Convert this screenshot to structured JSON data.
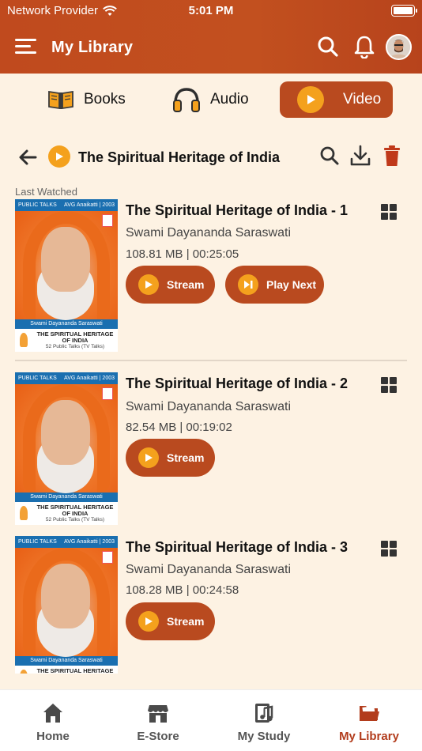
{
  "status_bar": {
    "carrier": "Network Provider",
    "time": "5:01 PM"
  },
  "header": {
    "title": "My Library"
  },
  "tabs": [
    {
      "label": "Books",
      "icon": "book-icon",
      "active": false
    },
    {
      "label": "Audio",
      "icon": "headphones-icon",
      "active": false
    },
    {
      "label": "Video",
      "icon": "play-icon",
      "active": true
    }
  ],
  "subheader": {
    "title": "The Spiritual Heritage of India"
  },
  "last_watched_label": "Last Watched",
  "thumbnail": {
    "series_label": "PUBLIC TALKS",
    "venue": "AVG Anaikatti | 2003",
    "speaker": "Swami Dayananda Saraswati",
    "book_title": "THE SPIRITUAL HERITAGE OF INDIA",
    "talks": "52 Public Talks (TV Talks)"
  },
  "items": [
    {
      "title": "The Spiritual Heritage of India - 1",
      "author": "Swami Dayananda Saraswati",
      "meta": "108.81 MB | 00:25:05",
      "stream_label": "Stream",
      "play_next_label": "Play Next"
    },
    {
      "title": "The Spiritual Heritage of India - 2",
      "author": "Swami Dayananda Saraswati",
      "meta": "82.54 MB | 00:19:02",
      "stream_label": "Stream"
    },
    {
      "title": "The Spiritual Heritage of India - 3",
      "author": "Swami Dayananda Saraswati",
      "meta": "108.28 MB | 00:24:58",
      "stream_label": "Stream"
    }
  ],
  "bottom_nav": [
    {
      "label": "Home",
      "icon": "home-icon",
      "active": false
    },
    {
      "label": "E-Store",
      "icon": "store-icon",
      "active": false
    },
    {
      "label": "My Study",
      "icon": "study-icon",
      "active": false
    },
    {
      "label": "My Library",
      "icon": "folder-icon",
      "active": true
    }
  ],
  "colors": {
    "brand": "#b94a1f",
    "accent": "#f4a11d",
    "background": "#fdf2e3",
    "active_nav": "#b23c1c"
  }
}
